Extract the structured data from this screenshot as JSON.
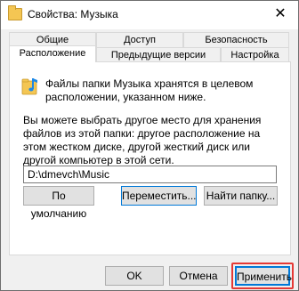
{
  "window": {
    "title": "Свойства: Музыка",
    "close_glyph": "✕"
  },
  "tabs": {
    "row1": [
      "Общие",
      "Доступ",
      "Безопасность"
    ],
    "row2": [
      "Расположение",
      "Предыдущие версии",
      "Настройка"
    ],
    "active": "Расположение"
  },
  "content": {
    "intro": "Файлы папки Музыка хранятся в целевом расположении, указанном ниже.",
    "description": "Вы можете выбрать другое место для хранения файлов из этой папки: другое расположение на этом жестком диске, другой жесткий диск или другой компьютер в этой сети.",
    "path_value": "D:\\dmevch\\Music",
    "buttons": {
      "default": "По умолчанию",
      "move": "Переместить...",
      "find": "Найти папку..."
    }
  },
  "footer": {
    "ok": "OK",
    "cancel": "Отмена",
    "apply": "Применить"
  },
  "colors": {
    "accent": "#0078d7",
    "highlight": "#e53935",
    "folder": "#f4c653",
    "music_note": "#1e88e5"
  },
  "icons": {
    "title": "folder-icon",
    "content": "music-folder-icon",
    "close": "close-icon"
  }
}
